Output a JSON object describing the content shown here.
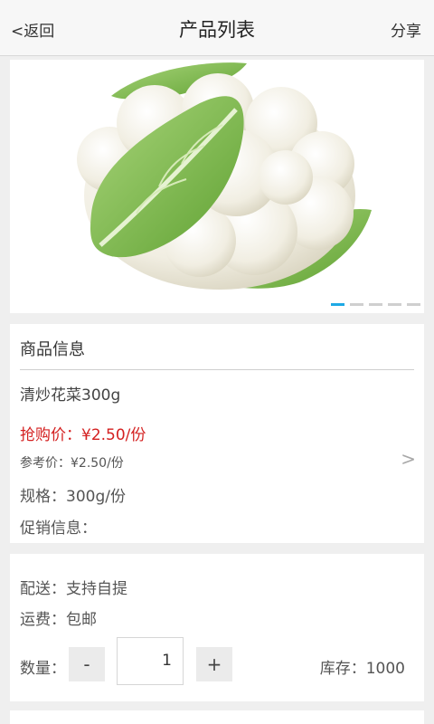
{
  "header": {
    "back_label": "<返回",
    "title": "产品列表",
    "share_label": "分享"
  },
  "gallery": {
    "image": "cauliflower-photo",
    "total_slides": 5,
    "active_slide": 1
  },
  "product": {
    "section_title": "商品信息",
    "name": "清炒花菜300g",
    "flash_price": "抢购价：¥2.50/份",
    "ref_price": "参考价：¥2.50/份",
    "spec": "规格：300g/份",
    "promo": "促销信息：",
    "more_icon": "chevron-right-icon"
  },
  "shipping": {
    "delivery": "配送：支持自提",
    "fee": "运费：包邮",
    "qty_label": "数量：",
    "minus": "-",
    "qty_value": "1",
    "plus": "+",
    "stock": "库存：1000"
  },
  "colors": {
    "accent": "#1ea9e5",
    "price_red": "#d42020",
    "background": "#efefef"
  }
}
